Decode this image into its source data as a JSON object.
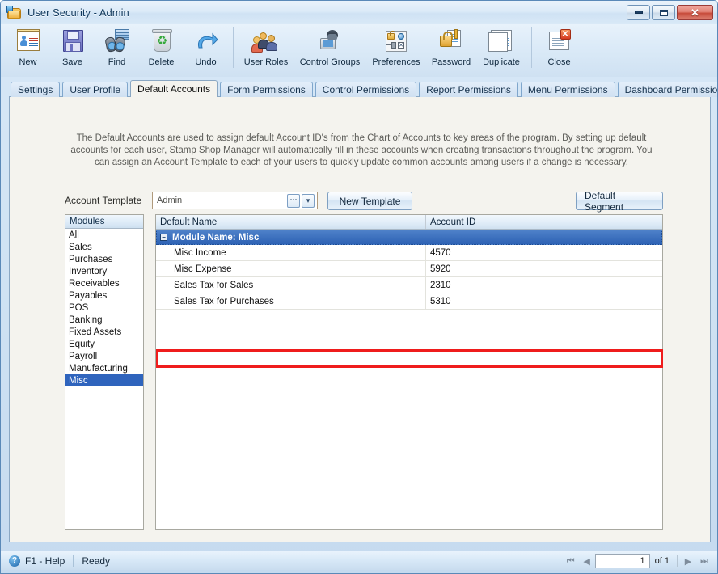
{
  "window": {
    "title": "User Security - Admin",
    "app_icon": "user-card-folder-icon",
    "minimize_label": "",
    "maximize_label": "",
    "close_label": "✕"
  },
  "toolbar": {
    "buttons": [
      {
        "label": "New",
        "icon": "new-record-icon"
      },
      {
        "label": "Save",
        "icon": "floppy-disk-icon"
      },
      {
        "label": "Find",
        "icon": "binoculars-icon"
      },
      {
        "label": "Delete",
        "icon": "recycle-bin-icon"
      },
      {
        "label": "Undo",
        "icon": "undo-arrow-icon"
      },
      {
        "label": "User Roles",
        "icon": "users-group-icon"
      },
      {
        "label": "Control Groups",
        "icon": "user-computer-icon"
      },
      {
        "label": "Preferences",
        "icon": "preferences-lock-icon"
      },
      {
        "label": "Password",
        "icon": "padlock-key-icon"
      },
      {
        "label": "Duplicate",
        "icon": "duplicate-pages-icon"
      },
      {
        "label": "Close",
        "icon": "close-document-icon"
      }
    ]
  },
  "tabs": [
    {
      "label": "Settings",
      "active": false
    },
    {
      "label": "User Profile",
      "active": false
    },
    {
      "label": "Default Accounts",
      "active": true
    },
    {
      "label": "Form Permissions",
      "active": false
    },
    {
      "label": "Control Permissions",
      "active": false
    },
    {
      "label": "Report Permissions",
      "active": false
    },
    {
      "label": "Menu Permissions",
      "active": false
    },
    {
      "label": "Dashboard Permissions",
      "active": false
    }
  ],
  "content": {
    "description": "The Default Accounts are used to assign default Account ID's from the Chart of Accounts to key areas of the program.  By setting up default accounts for each user, Stamp Shop Manager will automatically fill in these accounts when creating transactions throughout the program.  You can assign an Account Template to each of your users to quickly update common accounts among users if a change is necessary.",
    "account_template_label": "Account Template",
    "account_template_value": "Admin",
    "account_template_ellipsis": "···",
    "account_template_arrow": "▾",
    "new_template_button": "New Template",
    "default_segment_button": "Default Segment"
  },
  "modules": {
    "header": "Modules",
    "items": [
      {
        "label": "All",
        "selected": false
      },
      {
        "label": "Sales",
        "selected": false
      },
      {
        "label": "Purchases",
        "selected": false
      },
      {
        "label": "Inventory",
        "selected": false
      },
      {
        "label": "Receivables",
        "selected": false
      },
      {
        "label": "Payables",
        "selected": false
      },
      {
        "label": "POS",
        "selected": false
      },
      {
        "label": "Banking",
        "selected": false
      },
      {
        "label": "Fixed Assets",
        "selected": false
      },
      {
        "label": "Equity",
        "selected": false
      },
      {
        "label": "Payroll",
        "selected": false
      },
      {
        "label": "Manufacturing",
        "selected": false
      },
      {
        "label": "Misc",
        "selected": true
      }
    ]
  },
  "grid": {
    "columns": [
      "Default Name",
      "Account ID"
    ],
    "group_header": "Module Name: Misc",
    "group_expander": "−",
    "rows": [
      {
        "name": "Misc Income",
        "account_id": "4570",
        "highlighted": false
      },
      {
        "name": "Misc Expense",
        "account_id": "5920",
        "highlighted": true
      },
      {
        "name": "Sales Tax for Sales",
        "account_id": "2310",
        "highlighted": false
      },
      {
        "name": "Sales Tax for Purchases",
        "account_id": "5310",
        "highlighted": false
      }
    ],
    "highlight_color": "#ef1c1c"
  },
  "statusbar": {
    "help_icon": "help-question-icon",
    "help_label": "F1 - Help",
    "status": "Ready",
    "pager": {
      "first": "⏮",
      "prev": "◀",
      "page_value": "1",
      "of_text": "of 1",
      "next": "▶",
      "last": "⏭"
    }
  },
  "colors": {
    "accent": "#2f64bd",
    "highlight": "#ef1c1c",
    "frame": "#5a89b8"
  }
}
